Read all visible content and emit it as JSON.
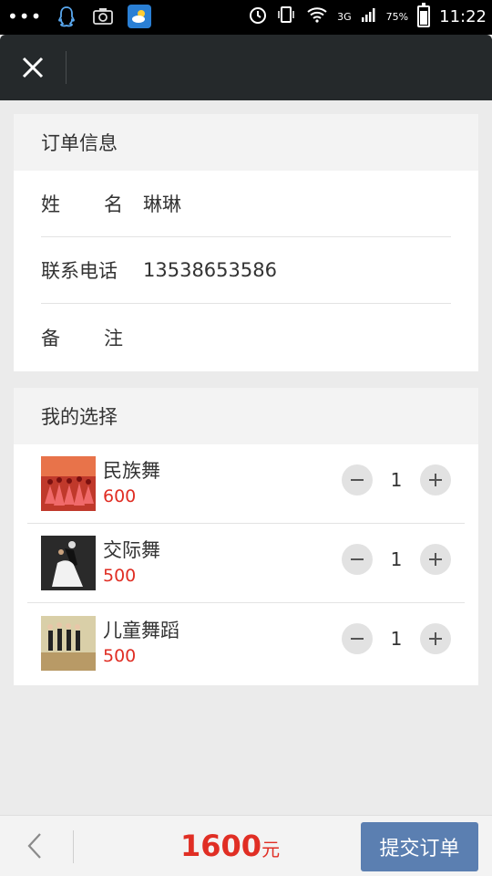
{
  "status_bar": {
    "dots": "•••",
    "signal_label": "3G",
    "battery": "75%",
    "time": "11:22"
  },
  "order_info": {
    "title": "订单信息",
    "rows": [
      {
        "label_a": "姓",
        "label_b": "名",
        "value": "琳琳"
      },
      {
        "label": "联系电话",
        "value": "13538653586"
      },
      {
        "label_a": "备",
        "label_b": "注",
        "value": ""
      }
    ]
  },
  "selection": {
    "title": "我的选择",
    "items": [
      {
        "name": "民族舞",
        "price": "600",
        "qty": "1"
      },
      {
        "name": "交际舞",
        "price": "500",
        "qty": "1"
      },
      {
        "name": "儿童舞蹈",
        "price": "500",
        "qty": "1"
      }
    ]
  },
  "footer": {
    "total": "1600",
    "unit": "元",
    "submit": "提交订单"
  },
  "colors": {
    "accent_red": "#e02e24",
    "submit_blue": "#5b7fb1",
    "navbar": "#25292b"
  },
  "icons": {
    "close": "close-icon",
    "back": "chevron-left-icon",
    "minus": "minus-icon",
    "plus": "plus-icon"
  }
}
